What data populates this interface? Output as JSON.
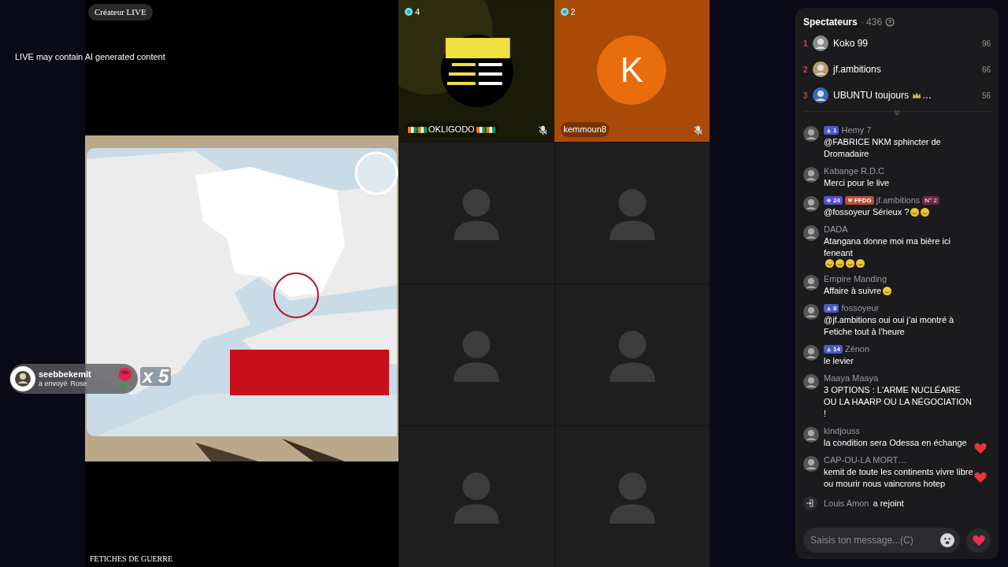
{
  "stream": {
    "creator_badge": "Créateur LIVE",
    "ai_notice": "LIVE may contain AI generated content",
    "caption": "FETICHES DE GUERRE",
    "kind": "picture"
  },
  "gift": {
    "sender": "seebbekemit",
    "action": "a envoyé",
    "gift_name": "Rose",
    "count": "x 5"
  },
  "guests": [
    {
      "kind": "video",
      "badge": "4",
      "name": "OKLIGODO",
      "flags": true,
      "muted": true
    },
    {
      "kind": "initial",
      "badge": "2",
      "initial": "K",
      "name": "kemmoun8",
      "flags": false,
      "muted": true
    },
    {
      "kind": "empty"
    },
    {
      "kind": "empty"
    },
    {
      "kind": "empty"
    },
    {
      "kind": "empty"
    },
    {
      "kind": "empty"
    },
    {
      "kind": "empty"
    }
  ],
  "viewers": {
    "title": "Spectateurs",
    "count": "· 436",
    "list": [
      {
        "rank": "1",
        "name": "Koko 99",
        "crown": false,
        "score": "96"
      },
      {
        "rank": "2",
        "name": "jf.ambitions",
        "crown": false,
        "score": "66"
      },
      {
        "rank": "3",
        "name": "UBUNTU toujours",
        "crown": true,
        "suffix": "…",
        "score": "56"
      }
    ]
  },
  "chat": [
    {
      "user": "Hemy 7",
      "badges": [
        {
          "kind": "level",
          "text": "1"
        }
      ],
      "text": "@FABRICE NKM sphincter de Dromadaire",
      "heart": false
    },
    {
      "user": "Kabange R.D.C",
      "text": "Merci pour le live",
      "heart": false
    },
    {
      "user": "jf.ambitions",
      "badges": [
        {
          "kind": "diamond",
          "text": "24"
        },
        {
          "kind": "fan",
          "text": "FFDG"
        }
      ],
      "rank_badge": "N° 2",
      "text": "@fossoyeur Sérieux ?",
      "emojis": [
        {
          "kind": "laugh"
        },
        {
          "kind": "laugh"
        }
      ],
      "heart": false
    },
    {
      "user": "DADA",
      "text": "Atangana donne moi ma bière ici feneant",
      "emojis": [
        {
          "kind": "laugh"
        },
        {
          "kind": "laugh"
        },
        {
          "kind": "laugh"
        },
        {
          "kind": "laugh"
        }
      ],
      "heart": false
    },
    {
      "user": "Empire Manding",
      "text": "Affaire à suivre",
      "emojis": [
        {
          "kind": "smirk"
        }
      ],
      "heart": false
    },
    {
      "user": "fossoyeur",
      "badges": [
        {
          "kind": "level",
          "text": "8"
        }
      ],
      "text": "@jf.ambitions oui oui j’ai montré à Fetiche tout à l’heure",
      "heart": false
    },
    {
      "user": "Zénon",
      "badges": [
        {
          "kind": "level",
          "text": "14"
        }
      ],
      "text": "le levier",
      "heart": false
    },
    {
      "user": "Maaya Maaya",
      "text": "3 OPTIONS : L'ARME NUCLÉAIRE OU LA HAARP OU LA NÉGOCIATION !",
      "heart": false
    },
    {
      "user": "kindjouss",
      "text": "la condition sera Odessa en échange",
      "heart": true
    },
    {
      "user": "CAP-OU-LA MORT…",
      "text": "kemit de toute les continents vivre libre ou mourir nous vaincrons hotep",
      "heart": true
    }
  ],
  "join": {
    "user": "Louis Amon",
    "action": "a rejoint"
  },
  "input": {
    "placeholder": "Saisis ton message...(C)"
  }
}
